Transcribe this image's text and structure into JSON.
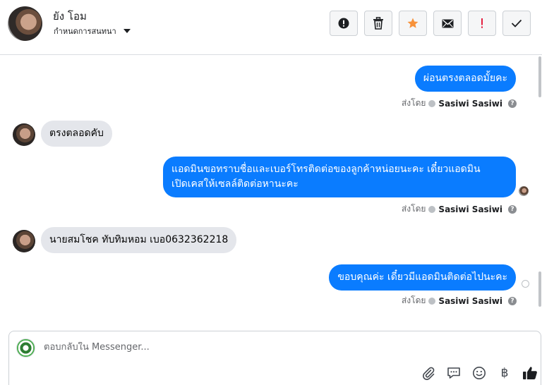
{
  "header": {
    "contact_name": "ยัง โอม",
    "assign_label": "กำหนดการสนทนา",
    "actions": [
      {
        "icon": "alert-circle-icon",
        "name": "mark-spam-button"
      },
      {
        "icon": "trash-icon",
        "name": "delete-button"
      },
      {
        "icon": "star-icon",
        "name": "star-button",
        "color": "#f7923b"
      },
      {
        "icon": "envelope-icon",
        "name": "mark-unread-button"
      },
      {
        "icon": "exclamation-icon",
        "name": "follow-up-button",
        "color": "#e41e3f"
      },
      {
        "icon": "check-icon",
        "name": "mark-done-button"
      }
    ]
  },
  "messages": [
    {
      "direction": "out",
      "text": "ผ่อนตรงตลอดมั้ยคะ"
    },
    {
      "direction": "meta",
      "sent_by_label": "ส่งโดย",
      "sender": "Sasiwi Sasiwi"
    },
    {
      "direction": "in",
      "text": "ตรงตลอดคับ"
    },
    {
      "direction": "out",
      "lines": [
        "แอดมินขอทราบชื่อและเบอร์โทรติดต่อของลูกค้าหน่อยนะคะ เดี๋ยวแอดมิน",
        "เปิดเคสให้เซลล์ติดต่อหานะคะ"
      ]
    },
    {
      "direction": "meta",
      "sent_by_label": "ส่งโดย",
      "sender": "Sasiwi Sasiwi"
    },
    {
      "direction": "in",
      "text": "นายสมโชค ทับทิมหอม เบอ0632362218"
    },
    {
      "direction": "out",
      "text": "ขอบคุณค่ะ เดี๋ยวมีแอดมินติดต่อไปนะคะ"
    },
    {
      "direction": "meta",
      "sent_by_label": "ส่งโดย",
      "sender": "Sasiwi Sasiwi"
    }
  ],
  "composer": {
    "placeholder": "ตอบกลับใน Messenger...",
    "value": "",
    "tools": [
      "paperclip-icon",
      "saved-reply-icon",
      "emoji-icon",
      "baht-icon",
      "thumbs-up-icon"
    ],
    "baht_symbol": "฿"
  },
  "colors": {
    "outgoing_bubble": "#0a7cff",
    "incoming_bubble": "#e4e6eb",
    "accent_star": "#f7923b",
    "accent_alert": "#e41e3f"
  }
}
